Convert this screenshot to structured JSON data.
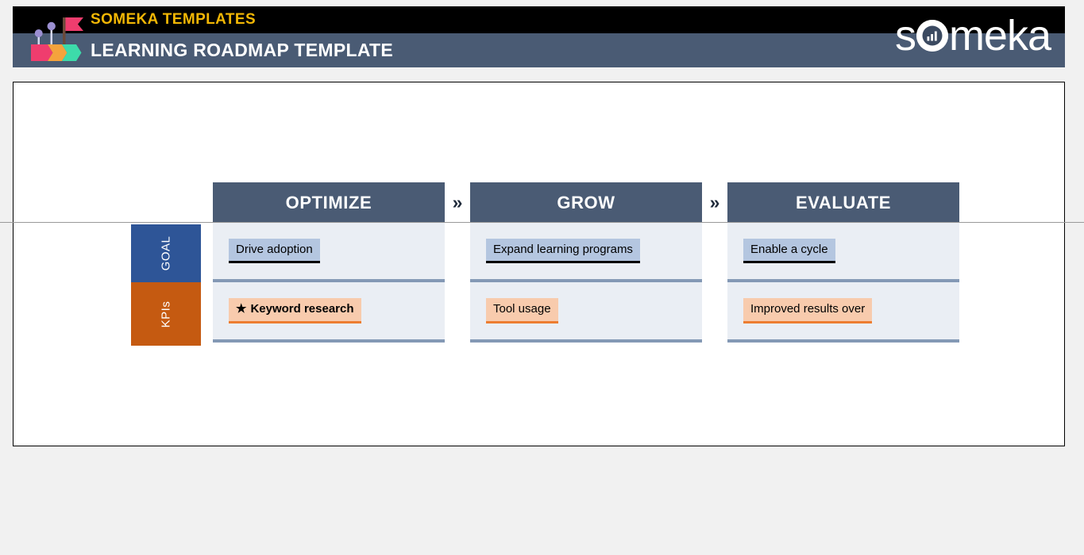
{
  "brand": {
    "templates_label": "SOMEKA TEMPLATES",
    "page_title": "LEARNING ROADMAP TEMPLATE",
    "wordmark_left": "s",
    "wordmark_right": "meka",
    "logo_icon": "flag-chevrons-logo",
    "colors": {
      "black_bar": "#000000",
      "slate_bar": "#4a5b74",
      "templates_text": "#f2b705",
      "title_text": "#ffffff"
    }
  },
  "roadmap": {
    "arrow_glyph": "»",
    "row_labels": [
      {
        "key": "goal",
        "label": "GOAL",
        "color": "#2e5597"
      },
      {
        "key": "kpis",
        "label": "KPIs",
        "color": "#c55a11"
      }
    ],
    "phases": [
      {
        "name": "OPTIMIZE",
        "goal": {
          "text": "Drive adoption",
          "starred": false
        },
        "kpi": {
          "text": "Keyword research",
          "starred": true,
          "star_glyph": "★"
        }
      },
      {
        "name": "GROW",
        "goal": {
          "text": "Expand learning programs",
          "starred": false
        },
        "kpi": {
          "text": "Tool usage",
          "starred": false,
          "star_glyph": ""
        }
      },
      {
        "name": "EVALUATE",
        "goal": {
          "text": "Enable a cycle",
          "starred": false
        },
        "kpi": {
          "text": "Improved results over",
          "starred": false,
          "star_glyph": ""
        }
      }
    ],
    "colors": {
      "phase_header_bg": "#4a5b74",
      "cell_bg": "#eaeef4",
      "cell_rule": "#8499b5",
      "goal_chip_bg": "#b4c6e0",
      "goal_chip_rule": "#000000",
      "kpi_chip_bg": "#f8cbad",
      "kpi_chip_rule": "#ed7d31"
    }
  }
}
